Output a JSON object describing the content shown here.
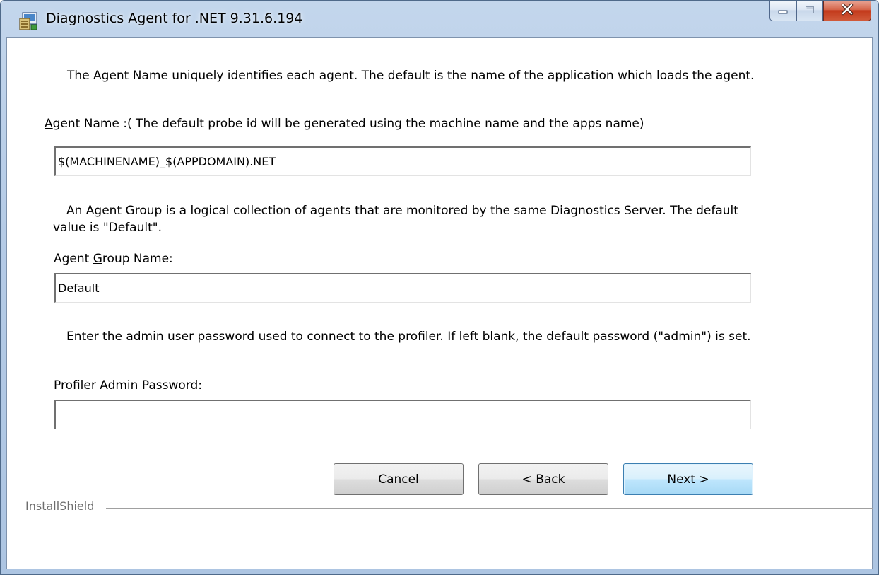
{
  "window": {
    "title": "Diagnostics Agent for .NET 9.31.6.194",
    "icon": "installer-icon",
    "caption_buttons": {
      "minimize": "minimize-icon",
      "maximize": "maximize-icon",
      "close": "close-icon"
    }
  },
  "agent_name": {
    "description": "The Agent Name uniquely identifies each agent. The default is the name of the application which loads the agent.",
    "label_mnemonic": "A",
    "label_rest": "gent Name :( The default probe id will be generated using the machine name and the apps name)",
    "value": "$(MACHINENAME)_$(APPDOMAIN).NET"
  },
  "agent_group": {
    "description": "An Agent Group is a logical collection of agents that are monitored by the same Diagnostics Server. The default value is \"Default\".",
    "label_before": "Agent ",
    "label_mnemonic": "G",
    "label_after": "roup Name:",
    "value": "Default"
  },
  "profiler": {
    "description": "Enter the admin user password used to connect to the profiler. If left blank, the default password (\"admin\") is set.",
    "label": "Profiler Admin Password:",
    "value": ""
  },
  "buttons": {
    "cancel_mnemonic": "C",
    "cancel_rest": "ancel",
    "back_before": "< ",
    "back_mnemonic": "B",
    "back_after": "ack",
    "next_mnemonic": "N",
    "next_after": "ext >"
  },
  "footer": {
    "brand": "InstallShield"
  },
  "colors": {
    "frame": "#b5cbe6",
    "close_button": "#c2391b",
    "default_button": "#bee6fd"
  }
}
